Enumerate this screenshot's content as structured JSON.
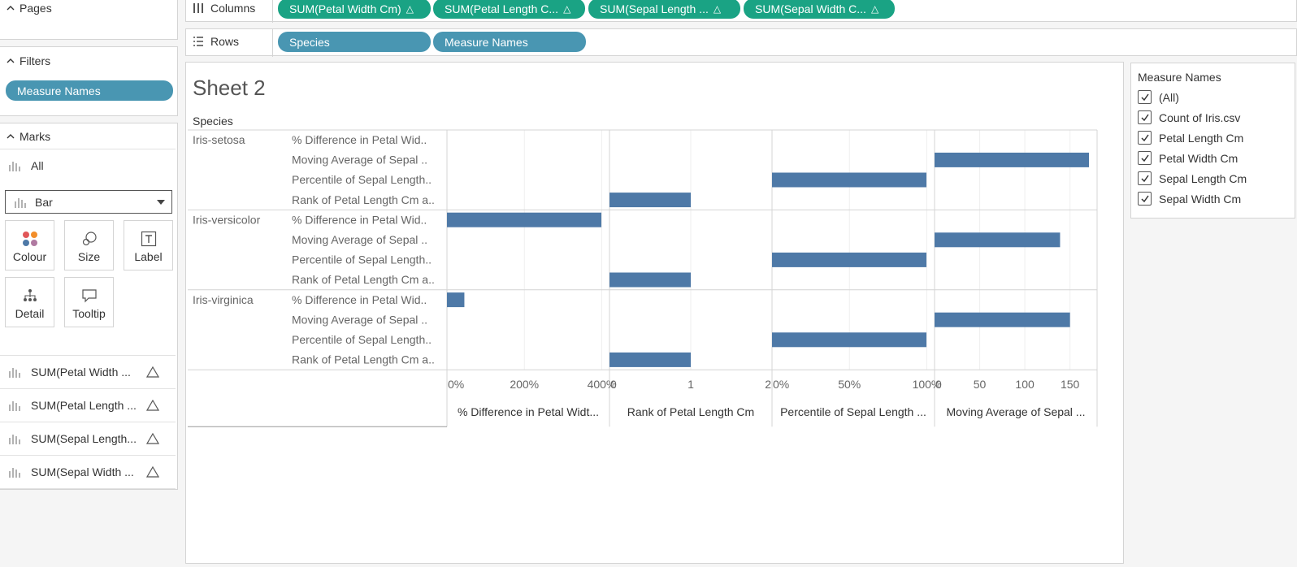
{
  "left_panel": {
    "pages_label": "Pages",
    "filters_label": "Filters",
    "filter_pill": "Measure Names",
    "marks_label": "Marks",
    "marks_all": "All",
    "mark_type": "Bar",
    "mark_buttons": [
      "Colour",
      "Size",
      "Label",
      "Detail",
      "Tooltip"
    ],
    "measure_cards": [
      "SUM(Petal Width ...",
      "SUM(Petal Length ...",
      "SUM(Sepal Length...",
      "SUM(Sepal Width ..."
    ]
  },
  "shelves": {
    "columns_label": "Columns",
    "columns_pills": [
      "SUM(Petal Width Cm)",
      "SUM(Petal Length C...",
      "SUM(Sepal Length ...",
      "SUM(Sepal Width C..."
    ],
    "rows_label": "Rows",
    "rows_pills": [
      "Species",
      "Measure Names"
    ]
  },
  "sheet": {
    "title": "Sheet 2",
    "species_header": "Species"
  },
  "legend": {
    "title": "Measure Names",
    "items": [
      "(All)",
      "Count of Iris.csv",
      "Petal Length Cm",
      "Petal Width Cm",
      "Sepal Length Cm",
      "Sepal Width Cm"
    ]
  },
  "colors": {
    "bar": "#4e79a7",
    "pill_blue": "#4996b2",
    "pill_green": "#1aa384"
  },
  "chart_data": {
    "type": "bar",
    "species": [
      "Iris-setosa",
      "Iris-versicolor",
      "Iris-virginica"
    ],
    "measure_labels": [
      "% Difference in Petal Wid..",
      "Moving Average of Sepal ..",
      "Percentile of Sepal Length..",
      "Rank of Petal Length Cm a.."
    ],
    "panes": [
      {
        "axis_title": "% Difference in Petal Widt...",
        "measure": "% Difference in Petal Width",
        "ticks": [
          "0%",
          "200%",
          "400%"
        ],
        "tick_values": [
          0,
          200,
          400
        ],
        "range": [
          0,
          420
        ]
      },
      {
        "axis_title": "Rank of Petal Length Cm",
        "measure": "Rank of Petal Length Cm",
        "ticks": [
          "0",
          "1",
          "2"
        ],
        "tick_values": [
          0,
          1,
          2
        ],
        "range": [
          0,
          2
        ]
      },
      {
        "axis_title": "Percentile of Sepal Length ...",
        "measure": "Percentile of Sepal Length",
        "ticks": [
          "0%",
          "50%",
          "100%"
        ],
        "tick_values": [
          0,
          50,
          100
        ],
        "range": [
          0,
          105
        ]
      },
      {
        "axis_title": "Moving Average of Sepal ...",
        "measure": "Moving Average of Sepal",
        "ticks": [
          "0",
          "50",
          "100",
          "150"
        ],
        "tick_values": [
          0,
          50,
          100,
          150
        ],
        "range": [
          0,
          180
        ]
      }
    ],
    "values": {
      "Iris-setosa": {
        "Moving Average of Sepal": 171,
        "Percentile of Sepal Length": 100,
        "Rank of Petal Length Cm": 1
      },
      "Iris-versicolor": {
        "% Difference in Petal Width": 400,
        "Moving Average of Sepal": 139,
        "Percentile of Sepal Length": 100,
        "Rank of Petal Length Cm": 1
      },
      "Iris-virginica": {
        "% Difference in Petal Width": 45,
        "Moving Average of Sepal": 150,
        "Percentile of Sepal Length": 100,
        "Rank of Petal Length Cm": 1
      }
    }
  }
}
